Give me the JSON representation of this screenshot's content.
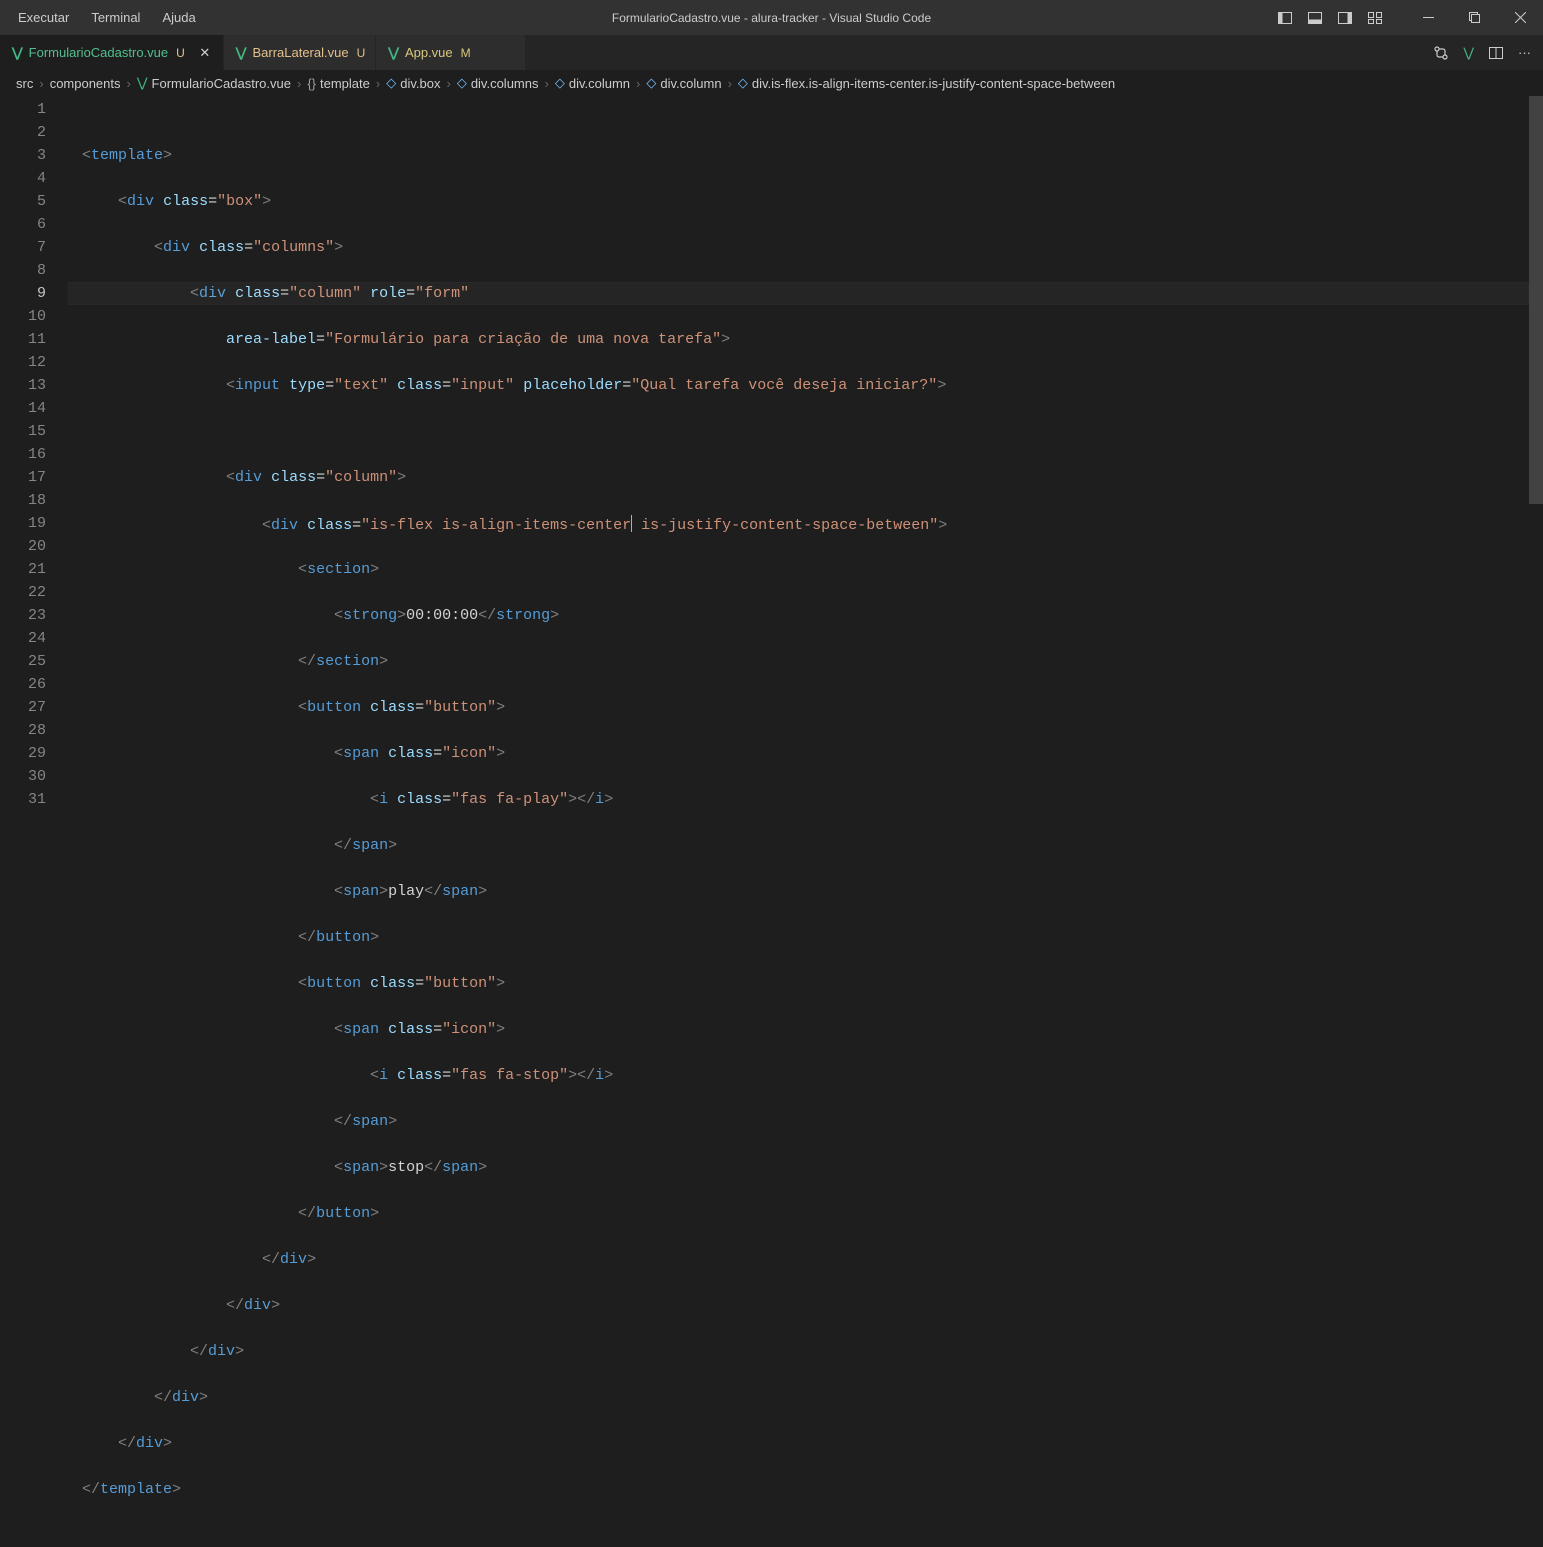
{
  "menu": {
    "executar": "Executar",
    "terminal": "Terminal",
    "ajuda": "Ajuda"
  },
  "window_title": "FormularioCadastro.vue - alura-tracker - Visual Studio Code",
  "tabs": [
    {
      "name": "FormularioCadastro.vue",
      "status": "U"
    },
    {
      "name": "BarraLateral.vue",
      "status": "U"
    },
    {
      "name": "App.vue",
      "status": "M"
    }
  ],
  "breadcrumbs": {
    "src": "src",
    "components": "components",
    "file": "FormularioCadastro.vue",
    "template": "template",
    "box": "div.box",
    "columns": "div.columns",
    "column1": "div.column",
    "column2": "div.column",
    "flex": "div.is-flex.is-align-items-center.is-justify-content-space-between"
  },
  "code": {
    "line1_template": "template",
    "line2_div": "div",
    "line2_class": "class",
    "line2_box": "\"box\"",
    "line3_div": "div",
    "line3_class": "class",
    "line3_columns": "\"columns\"",
    "line4_div": "div",
    "line4_class": "class",
    "line4_column": "\"column\"",
    "line4_role": "role",
    "line4_form": "\"form\"",
    "line5_area": "area-label",
    "line5_val": "\"Formulário para criação de uma nova tarefa\"",
    "line6_input": "input",
    "line6_type": "type",
    "line6_text": "\"text\"",
    "line6_class": "class",
    "line6_input2": "\"input\"",
    "line6_ph": "placeholder",
    "line6_phval": "\"Qual tarefa você deseja iniciar?\"",
    "line8_div": "div",
    "line8_class": "class",
    "line8_column": "\"column\"",
    "line9_div": "div",
    "line9_class": "class",
    "line9_val": "\"is-flex is-align-items-center",
    "line9_val2": " is-justify-content-space-between\"",
    "line10_section": "section",
    "line11_strong": "strong",
    "line11_time": "00:00:00",
    "line12_section": "section",
    "line13_button": "button",
    "line13_class": "class",
    "line13_val": "\"button\"",
    "line14_span": "span",
    "line14_class": "class",
    "line14_icon": "\"icon\"",
    "line15_i": "i",
    "line15_class": "class",
    "line15_val": "\"fas fa-play\"",
    "line16_span": "span",
    "line17_span": "span",
    "line17_play": "play",
    "line18_button": "button",
    "line19_button": "button",
    "line19_class": "class",
    "line19_val": "\"button\"",
    "line20_span": "span",
    "line20_class": "class",
    "line20_icon": "\"icon\"",
    "line21_i": "i",
    "line21_class": "class",
    "line21_val": "\"fas fa-stop\"",
    "line22_span": "span",
    "line23_span": "span",
    "line23_stop": "stop",
    "line24_button": "button",
    "line25_div": "div",
    "line26_div": "div",
    "line27_div": "div",
    "line28_div": "div",
    "line29_div": "div",
    "line30_template": "template"
  },
  "line_numbers": [
    "1",
    "2",
    "3",
    "4",
    "5",
    "6",
    "7",
    "8",
    "9",
    "10",
    "11",
    "12",
    "13",
    "14",
    "15",
    "16",
    "17",
    "18",
    "19",
    "20",
    "21",
    "22",
    "23",
    "24",
    "25",
    "26",
    "27",
    "28",
    "29",
    "30",
    "31"
  ]
}
